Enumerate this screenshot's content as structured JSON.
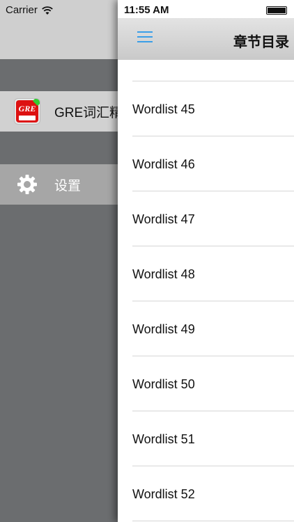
{
  "status_bar": {
    "carrier": "Carrier",
    "time": "11:55 AM"
  },
  "drawer": {
    "items": [
      {
        "label": "GRE词汇精选",
        "icon": "app-logo-icon"
      },
      {
        "label": "设置",
        "icon": "gear-icon"
      }
    ]
  },
  "nav": {
    "title": "章节目录",
    "menu_icon": "hamburger-icon",
    "accent": "#3a9ee8"
  },
  "wordlists": [
    "Wordlist 45",
    "Wordlist 46",
    "Wordlist 47",
    "Wordlist 48",
    "Wordlist 49",
    "Wordlist 50",
    "Wordlist 51",
    "Wordlist 52"
  ]
}
